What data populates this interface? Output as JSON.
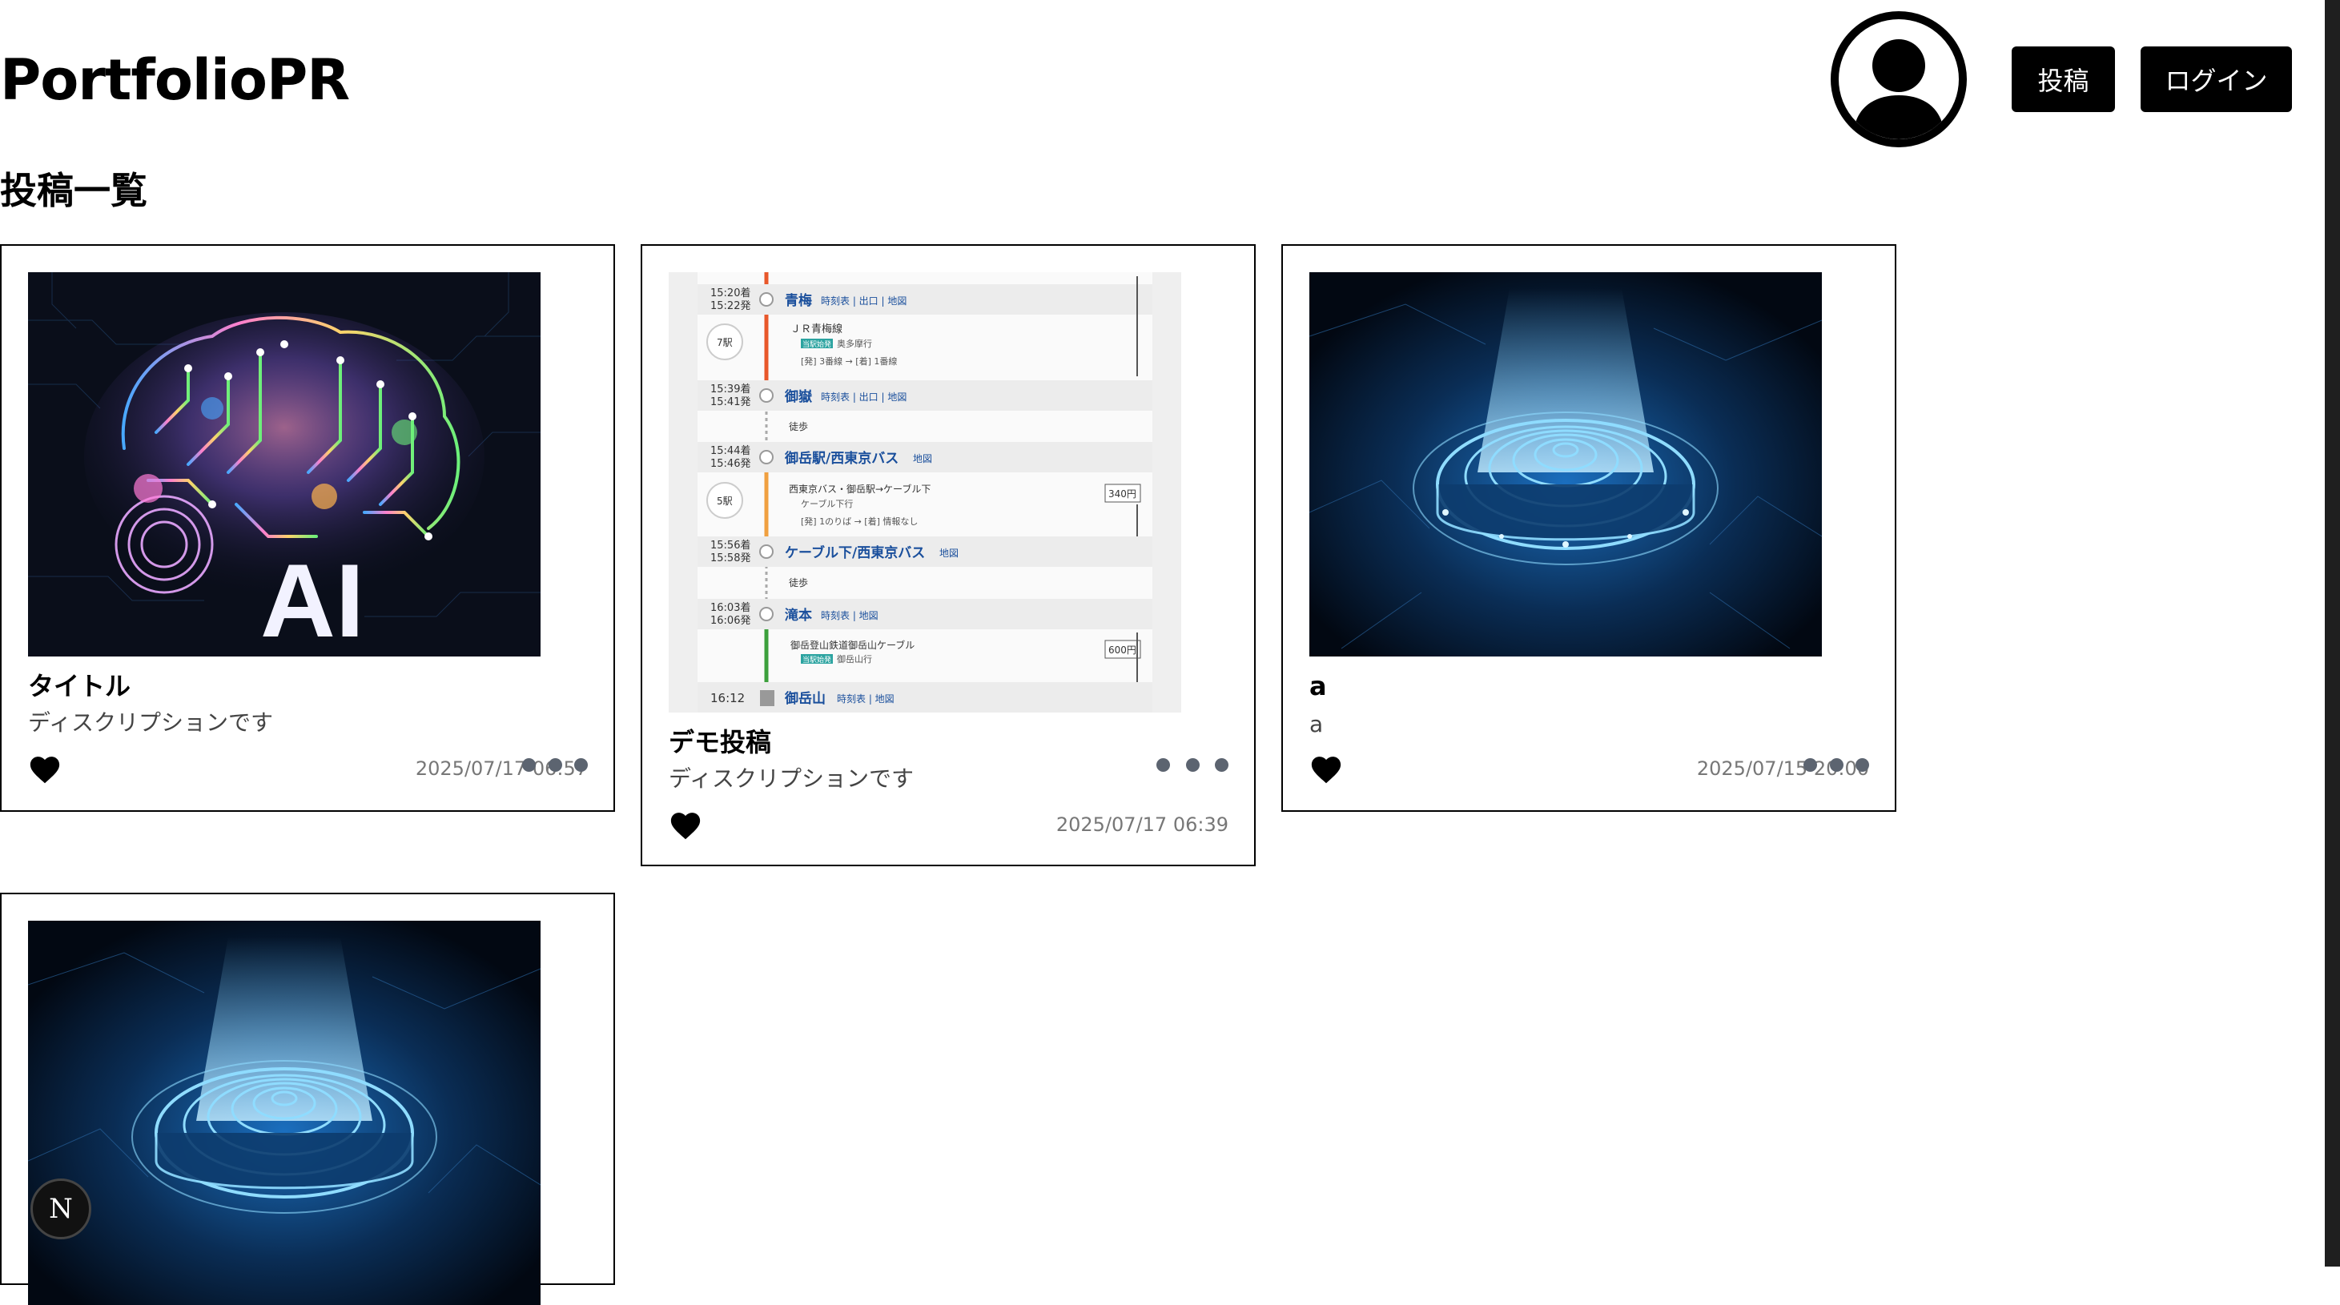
{
  "header": {
    "site_title": "PortfolioPR",
    "post_button": "投稿",
    "login_button": "ログイン",
    "avatar_icon": "user-avatar-icon"
  },
  "page": {
    "heading": "投稿一覧"
  },
  "posts": [
    {
      "title": "タイトル",
      "description": "ディスクリプションです",
      "date": "2025/07/17 06:57",
      "liked": true,
      "image": "ai-brain-circuit-image"
    },
    {
      "title": "デモ投稿",
      "description": "ディスクリプションです",
      "date": "2025/07/17 06:39",
      "liked": true,
      "image": "train-route-screenshot-image"
    },
    {
      "title": "a",
      "description": "a",
      "date": "2025/07/15 20:00",
      "liked": true,
      "image": "cyber-hologram-platform-image"
    },
    {
      "title": "",
      "description": "",
      "date": "",
      "liked": false,
      "image": "cyber-hologram-platform-image"
    }
  ],
  "route": {
    "stops": [
      {
        "times": [
          "15:20着",
          "15:22発"
        ],
        "name": "青梅",
        "links": "時刻表 | 出口 | 地図"
      },
      {
        "times": [
          "15:39着",
          "15:41発"
        ],
        "name": "御嶽",
        "links": "時刻表 | 出口 | 地図"
      },
      {
        "times": [
          "15:44着",
          "15:46発"
        ],
        "name": "御岳駅/西東京バス",
        "links": "地図"
      },
      {
        "times": [
          "15:56着",
          "15:58発"
        ],
        "name": "ケーブル下/西東京バス",
        "links": "地図"
      },
      {
        "times": [
          "16:03着",
          "16:06発"
        ],
        "name": "滝本",
        "links": "時刻表 | 地図"
      },
      {
        "times": [
          "16:12"
        ],
        "name": "御岳山",
        "links": "時刻表 | 地図"
      }
    ],
    "segments": [
      {
        "badge": "7駅",
        "line": "ＪＲ青梅線",
        "sub": "奥多摩行",
        "platform": "[発] 3番線 → [着] 1番線",
        "fare": ""
      },
      {
        "badge": "",
        "line": "徒歩",
        "sub": "",
        "platform": "",
        "fare": ""
      },
      {
        "badge": "5駅",
        "line": "西東京バス・御岳駅→ケーブル下",
        "sub": "ケーブル下行",
        "platform": "[発] 1のりば → [着] 情報なし",
        "fare": "340円"
      },
      {
        "badge": "",
        "line": "徒歩",
        "sub": "",
        "platform": "",
        "fare": ""
      },
      {
        "badge": "",
        "line": "御岳登山鉄道御岳山ケーブル",
        "sub": "御岳山行",
        "platform": "",
        "fare": "600円"
      }
    ],
    "label_direct": "当駅始発",
    "ai_text": "AI"
  },
  "colors": {
    "button_bg": "#000000",
    "dots": "#5c6470",
    "route_line_orange": "#e8572a",
    "route_line_green": "#3ca03c",
    "station_blue": "#1a4f9c"
  },
  "dev_badge": {
    "letter": "N"
  }
}
